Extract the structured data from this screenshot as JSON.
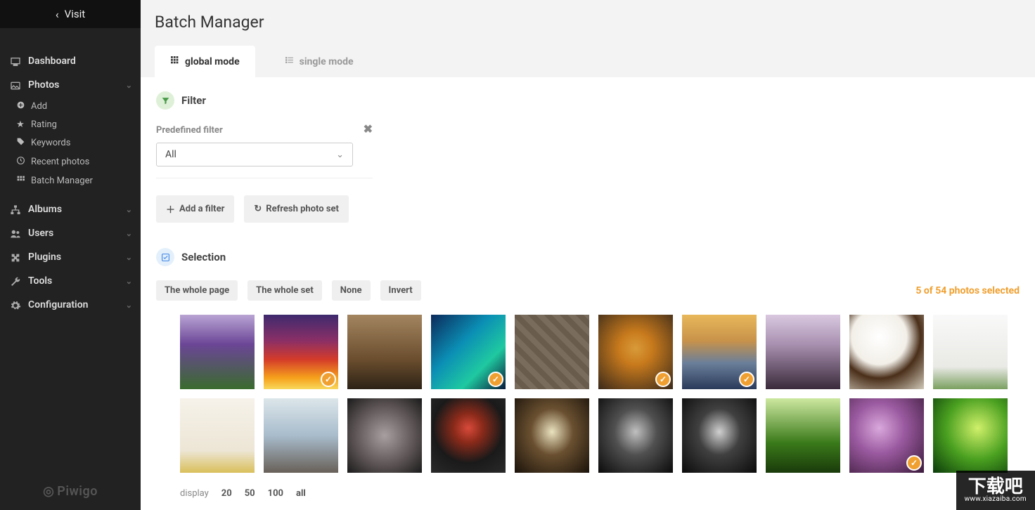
{
  "visit_label": "Visit",
  "brand": "Piwigo",
  "page_title": "Batch Manager",
  "sidebar": {
    "dashboard": "Dashboard",
    "photos": "Photos",
    "photos_sub": {
      "add": "Add",
      "rating": "Rating",
      "keywords": "Keywords",
      "recent": "Recent photos",
      "batch": "Batch Manager"
    },
    "albums": "Albums",
    "users": "Users",
    "plugins": "Plugins",
    "tools": "Tools",
    "configuration": "Configuration"
  },
  "tabs": {
    "global": "global mode",
    "single": "single mode"
  },
  "filter": {
    "title": "Filter",
    "predefined_label": "Predefined filter",
    "selected": "All",
    "add_filter": "Add a filter",
    "refresh": "Refresh photo set"
  },
  "selection": {
    "title": "Selection",
    "whole_page": "The whole page",
    "whole_set": "The whole set",
    "none": "None",
    "invert": "Invert",
    "status": "5 of 54 photos selected"
  },
  "thumbs": [
    {
      "selected": false,
      "g": "linear-gradient(180deg,#b9a4d4 0%,#6b4596 40%,#3a6b2e 100%)"
    },
    {
      "selected": true,
      "g": "linear-gradient(180deg,#3e2a6e 0%,#8b2f66 35%,#d43b2a 60%,#f6a21c 85%,#f8d85c 100%)"
    },
    {
      "selected": false,
      "g": "linear-gradient(180deg,#a38560 0%,#6b4e2e 60%,#2c2216 100%)"
    },
    {
      "selected": true,
      "g": "linear-gradient(135deg,#0b2a5b 0%,#0b8fb5 40%,#1fc9a0 70%,#0a1a3a 100%)"
    },
    {
      "selected": false,
      "g": "repeating-linear-gradient(45deg,#7a6c5d 0 8px,#6a5c4d 8px 16px)"
    },
    {
      "selected": true,
      "g": "radial-gradient(circle at 50% 45%,#d99b3a 0%,#c87a1c 30%,#3a2a1a 100%)"
    },
    {
      "selected": true,
      "g": "linear-gradient(180deg,#e8b85a 0%,#c8924a 35%,#6a7f9a 65%,#2a3a5a 100%)"
    },
    {
      "selected": false,
      "g": "linear-gradient(180deg,#d9c8e0 0%,#a890b0 40%,#3a2a3a 100%)"
    },
    {
      "selected": false,
      "g": "radial-gradient(circle at 40% 30%,#ffffff 0%,#f2efe8 40%,#4a2f1a 60%,#d0c8b8 100%)"
    },
    {
      "selected": false,
      "g": "linear-gradient(180deg,#f9f9f9 0%,#e9e9e5 70%,#7aa060 100%)"
    },
    {
      "selected": false,
      "g": "linear-gradient(180deg,#f6f2ea 0%,#ede6d6 70%,#d9bf5a 100%)"
    },
    {
      "selected": false,
      "g": "linear-gradient(180deg,#dce6ea 0%,#a8bccc 50%,#686058 100%)"
    },
    {
      "selected": false,
      "g": "radial-gradient(circle at 50% 50%,#a8a0a0 0%,#585050 60%,#1a1a1a 100%)"
    },
    {
      "selected": false,
      "g": "radial-gradient(circle at 50% 40%,#d84a3a 0%,#8b2a1a 25%,#1a1a1a 60%,#2a2a2a 100%)"
    },
    {
      "selected": false,
      "g": "radial-gradient(ellipse at 50% 45%,#eae2c0 0%,#6a5030 40%,#1a120a 100%)"
    },
    {
      "selected": false,
      "g": "radial-gradient(ellipse at 50% 45%,#c0c0c0 0%,#505050 40%,#0a0a0a 100%)"
    },
    {
      "selected": false,
      "g": "radial-gradient(ellipse at 50% 45%,#d0d0d0 0%,#404040 40%,#0a0a0a 100%)"
    },
    {
      "selected": false,
      "g": "linear-gradient(180deg,#cde8a0 0%,#3a7a1a 60%,#1a3a0a 100%)"
    },
    {
      "selected": true,
      "g": "radial-gradient(circle at 40% 40%,#d9a8dc 0%,#9b5aa0 40%,#3a1a3a 100%)"
    },
    {
      "selected": false,
      "g": "radial-gradient(circle at 60% 40%,#d0f06a 0%,#4aa020 50%,#0a3a0a 100%)"
    }
  ],
  "pager": {
    "label": "display",
    "opts": [
      "20",
      "50",
      "100",
      "all"
    ]
  },
  "watermark": {
    "big": "下载吧",
    "url": "www.xiazaiba.com"
  }
}
